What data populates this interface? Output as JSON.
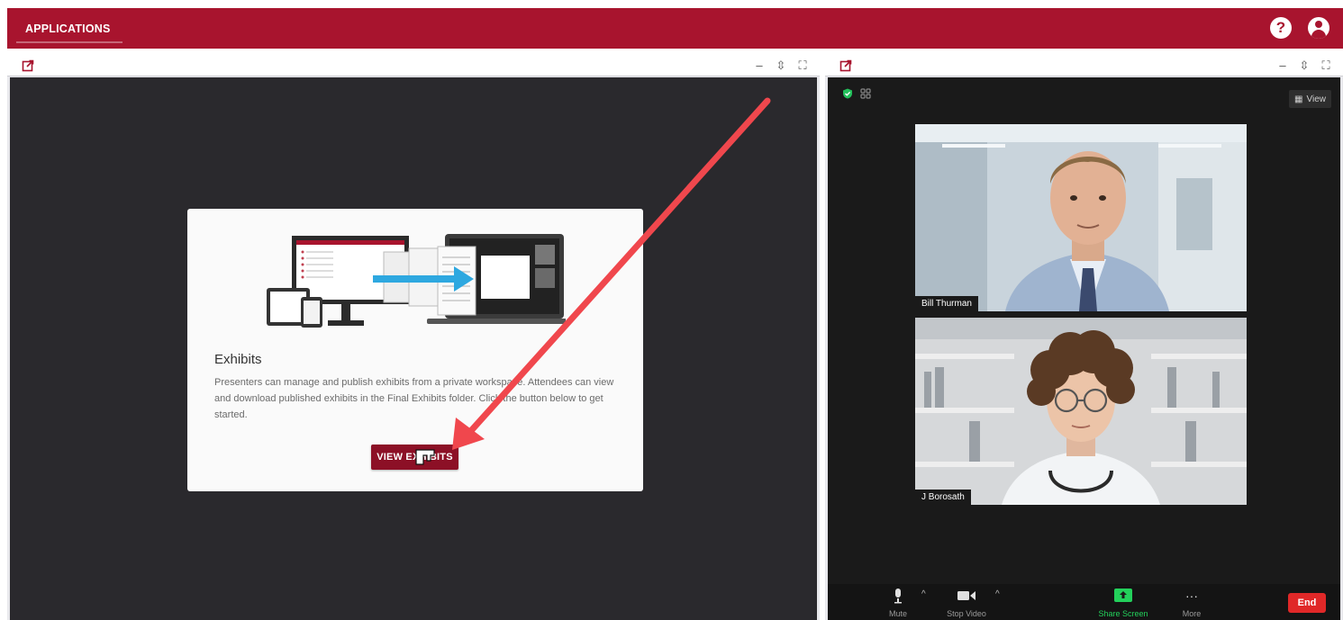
{
  "app": {
    "tab_label": "APPLICATIONS",
    "help_icon": "help-circle-icon",
    "account_icon": "account-icon"
  },
  "left_panel": {
    "popout_icon": "popout-icon",
    "controls": [
      "–",
      "⇕",
      "⛶"
    ],
    "card": {
      "title": "Exhibits",
      "description": "Presenters can manage and publish exhibits from a private workspace. Attendees can view and download published exhibits in the Final Exhibits folder. Click the button below to get started.",
      "button_label": "VIEW EXHIBITS"
    }
  },
  "right_panel": {
    "popout_icon": "popout-icon",
    "controls": [
      "–",
      "⇕",
      "⛶"
    ],
    "view_label": "View",
    "participants": [
      {
        "name": "Bill Thurman"
      },
      {
        "name": "J Borosath"
      }
    ],
    "toolbar": {
      "mute_label": "Mute",
      "video_label": "Stop Video",
      "share_label": "Share Screen",
      "more_label": "More",
      "end_label": "End"
    }
  },
  "colors": {
    "brand": "#a8142e",
    "button": "#8c1026",
    "annotation_arrow": "#f0474d",
    "share_green": "#23d05b",
    "end_red": "#e02828"
  }
}
